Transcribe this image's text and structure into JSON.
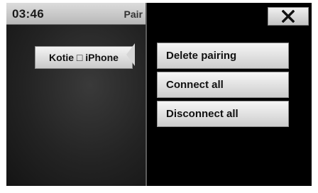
{
  "status": {
    "time": "03:46",
    "screen_title": "Pair"
  },
  "device_list": {
    "selected_device": "Kotie □ iPhone"
  },
  "popup": {
    "close_icon": "close-icon",
    "items": [
      {
        "label": "Delete pairing"
      },
      {
        "label": "Connect all"
      },
      {
        "label": "Disconnect all"
      }
    ]
  }
}
